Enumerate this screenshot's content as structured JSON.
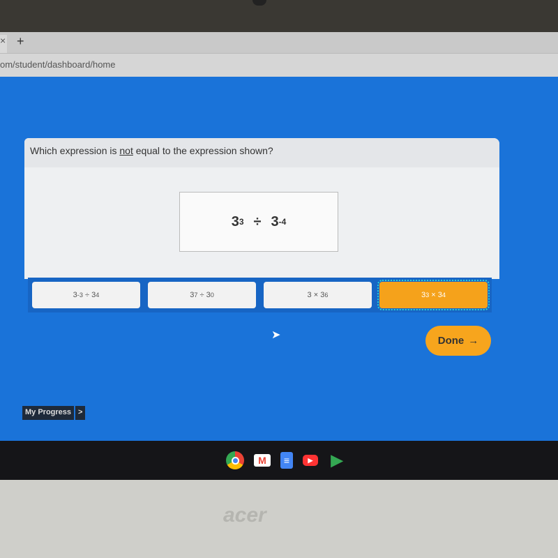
{
  "browser": {
    "tab_close": "×",
    "new_tab": "+",
    "url": "om/student/dashboard/home"
  },
  "question": {
    "before": "Which expression is ",
    "emph": "not",
    "after": " equal to the expression shown?"
  },
  "expression": {
    "base1": "3",
    "exp1": "3",
    "op": "÷",
    "base2": "3",
    "exp2": "-4"
  },
  "answers": [
    {
      "base1": "3",
      "exp1": "-3",
      "op": "÷",
      "base2": "3",
      "exp2": "4",
      "selected": false
    },
    {
      "base1": "3",
      "exp1": "7",
      "op": "÷",
      "base2": "3",
      "exp2": "0",
      "selected": false
    },
    {
      "base1": "3",
      "exp1": "",
      "op": "×",
      "base2": "3",
      "exp2": "6",
      "selected": false
    },
    {
      "base1": "3",
      "exp1": "3",
      "op": "×",
      "base2": "3",
      "exp2": "4",
      "selected": true
    }
  ],
  "done": {
    "label": "Done",
    "arrow": "→"
  },
  "progress": {
    "label": "My Progress",
    "arrow": ">"
  },
  "taskbar": [
    "chrome-icon",
    "gmail-icon",
    "docs-icon",
    "youtube-icon",
    "play-store-icon"
  ],
  "laptop_logo": "acer",
  "colors": {
    "stage": "#1a73d9",
    "selected": "#f5a21b",
    "done": "#f7a51d"
  }
}
